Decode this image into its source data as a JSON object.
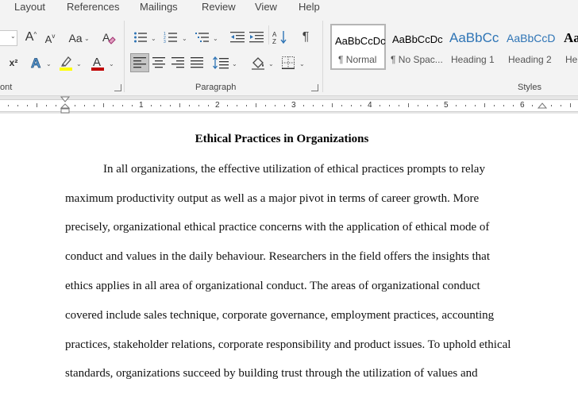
{
  "menu": [
    "Layout",
    "References",
    "Mailings",
    "Review",
    "View",
    "Help"
  ],
  "ribbon": {
    "groups": {
      "font": "ont",
      "paragraph": "Paragraph",
      "styles": "Styles"
    },
    "font": {
      "grow_font": "A",
      "shrink_font": "A",
      "change_case": "Aa",
      "superscript": "x²"
    },
    "styles": [
      {
        "sample": "AaBbCcDc",
        "name": "¶ Normal"
      },
      {
        "sample": "AaBbCcDc",
        "name": "¶ No Spac..."
      },
      {
        "sample": "AaBbCc",
        "name": "Heading 1"
      },
      {
        "sample": "AaBbCcD",
        "name": "Heading 2"
      },
      {
        "sample": "Aa",
        "name": "He"
      }
    ],
    "colors": {
      "highlight": "#ffff00",
      "font_color": "#c00000",
      "heading_blue": "#2e74b5"
    }
  },
  "ruler": {
    "numbers": [
      "1",
      "2",
      "3",
      "4",
      "5",
      "6"
    ]
  },
  "document": {
    "title": "Ethical Practices in Organizations",
    "lines": [
      "In all organizations, the effective utilization of ethical practices prompts to relay",
      "maximum productivity output as well as a major pivot in terms of career growth. More",
      "precisely, organizational ethical practice concerns with the application of ethical mode of",
      "conduct and values in the daily behaviour. Researchers in the field offers the insights that",
      "ethics applies in all area of organizational conduct. The areas of organizational conduct",
      "covered include sales technique, corporate governance, employment practices, accounting",
      "practices, stakeholder relations, corporate responsibility and product issues. To uphold ethical",
      "standards, organizations succeed by building trust through the utilization of values and"
    ]
  }
}
